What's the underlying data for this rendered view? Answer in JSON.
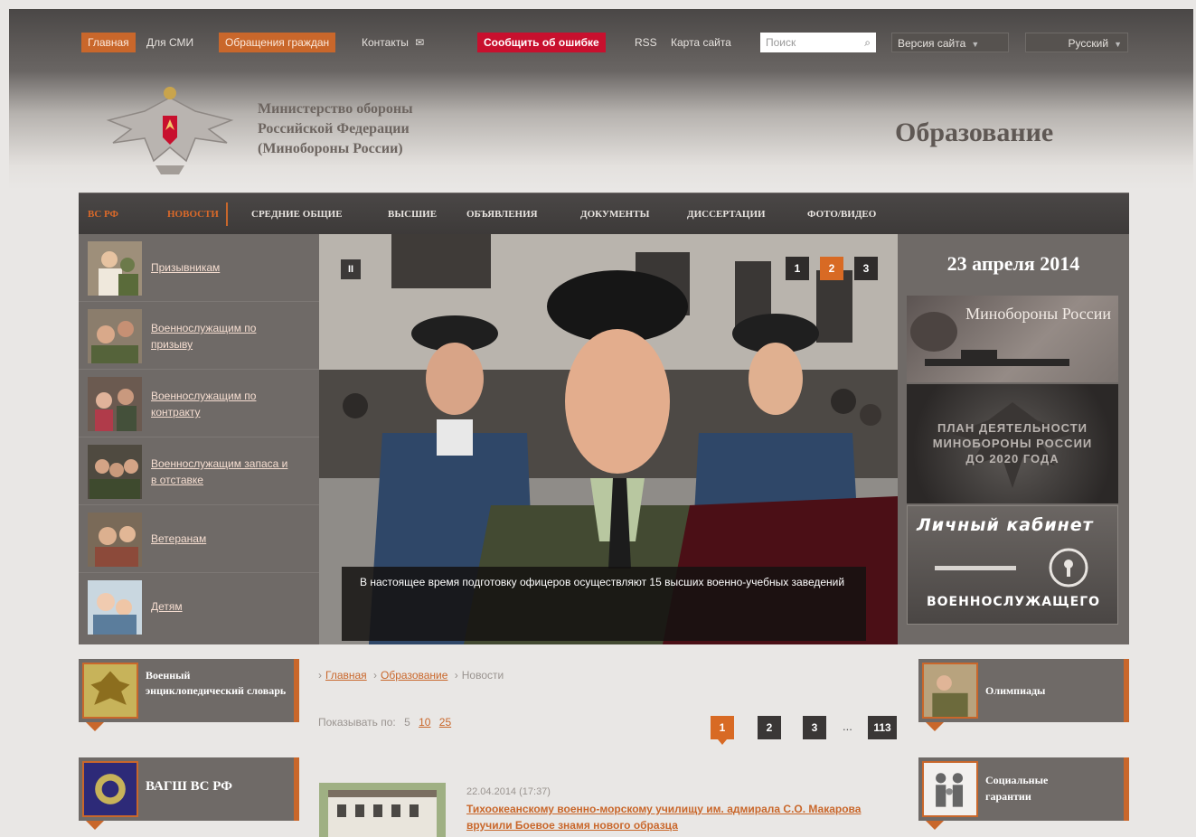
{
  "topbar": {
    "home": "Главная",
    "media": "Для СМИ",
    "appeals": "Обращения граждан",
    "contacts": "Контакты",
    "report_error": "Сообщить об ошибке",
    "rss": "RSS",
    "sitemap": "Карта сайта",
    "search_placeholder": "Поиск",
    "site_version": "Версия сайта",
    "language": "Русский"
  },
  "header": {
    "ministry_line1": "Министерство обороны",
    "ministry_line2": "Российской Федерации",
    "ministry_line3": "(Минобороны России)",
    "section_title": "Образование"
  },
  "nav": {
    "items": [
      "ВС РФ",
      "Новости",
      "Средние общие",
      "Высшие",
      "Объявления",
      "Документы",
      "Диссертации",
      "Фото/видео"
    ]
  },
  "categories": [
    "Призывникам",
    "Военнослужащим по призыву",
    "Военнослужащим по контракту",
    "Военнослужащим запаса и в отставке",
    "Ветеранам",
    "Детям"
  ],
  "slider": {
    "pause": "II",
    "pages": [
      "1",
      "2",
      "3"
    ],
    "active_page": "2",
    "caption": "В настоящее время подготовку офицеров осуществляют 15 высших военно-учебных заведений"
  },
  "right": {
    "date": "23 апреля 2014",
    "banner1": "Минобороны России",
    "banner2_line1": "ПЛАН ДЕЯТЕЛЬНОСТИ",
    "banner2_line2": "МИНОБОРОНЫ РОССИИ",
    "banner2_line3": "ДО 2020 ГОДА",
    "banner3_line1": "Личный кабинет",
    "banner3_line2": "ВОЕННОСЛУЖАЩЕГО"
  },
  "left_boxes": {
    "dictionary": "Военный энциклопедический словарь",
    "vagsh": "ВАГШ ВС РФ"
  },
  "right_boxes": {
    "olympiads": "Олимпиады",
    "social": "Социальные гарантии"
  },
  "breadcrumbs": [
    "Главная",
    "Образование",
    "Новости"
  ],
  "perpage": {
    "label": "Показывать по:",
    "options": [
      "5",
      "10",
      "25"
    ]
  },
  "pagination": {
    "pages": [
      "1",
      "2",
      "3"
    ],
    "ellipsis": "...",
    "last": "113"
  },
  "news": {
    "date": "22.04.2014 (17:37)",
    "title": "Тихоокеанскому военно-морскому училищу им. адмирала С.О. Макарова вручили Боевое знамя нового образца"
  },
  "colors": {
    "accent": "#c9672b",
    "error": "#c8102e",
    "panel": "#6f6a67"
  }
}
